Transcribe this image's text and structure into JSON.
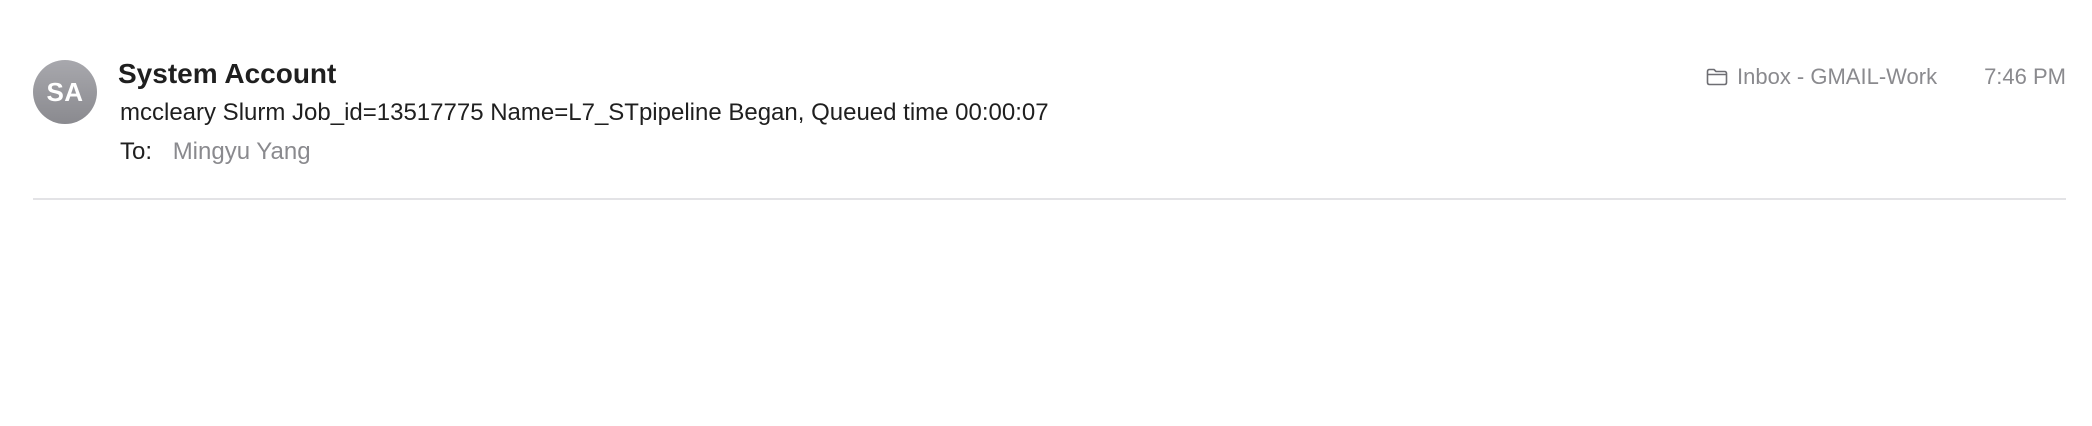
{
  "message": {
    "avatar_initials": "SA",
    "sender_name": "System Account",
    "subject": "mccleary Slurm Job_id=13517775 Name=L7_STpipeline Began, Queued time 00:00:07",
    "to_label": "To:",
    "to_value": "Mingyu Yang",
    "mailbox": "Inbox - GMAIL-Work",
    "time": "7:46 PM"
  },
  "icons": {
    "mailbox_icon": "folder-icon"
  },
  "colors": {
    "avatar_bg": "#9a9a9f",
    "secondary_text": "#8a8a8e",
    "primary_text": "#1f1f1f",
    "divider": "#e3e3e6"
  }
}
